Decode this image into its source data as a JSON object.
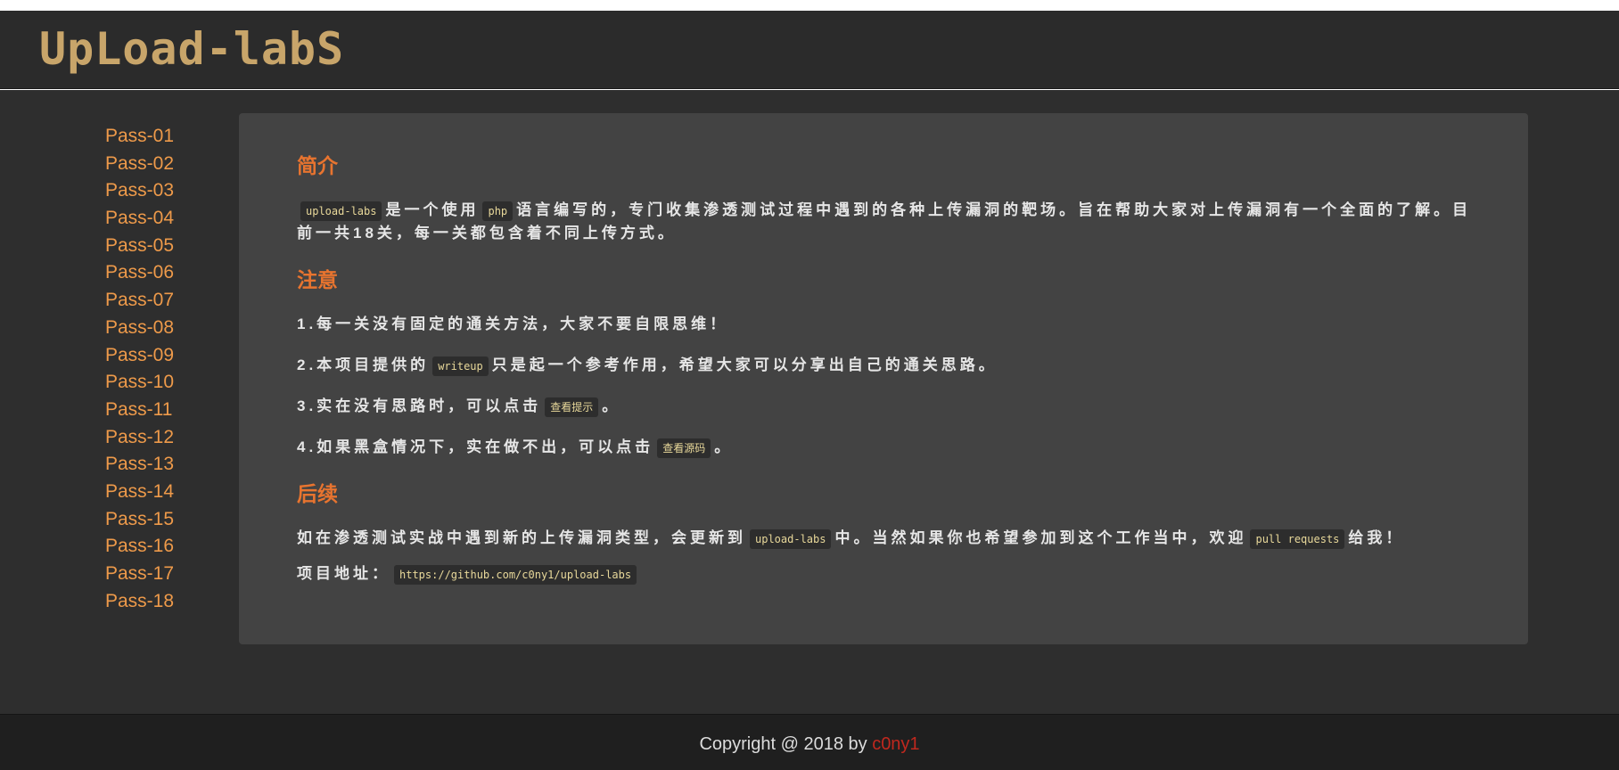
{
  "header": {
    "logo": "UpLoad-labS"
  },
  "sidebar": {
    "items": [
      "Pass-01",
      "Pass-02",
      "Pass-03",
      "Pass-04",
      "Pass-05",
      "Pass-06",
      "Pass-07",
      "Pass-08",
      "Pass-09",
      "Pass-10",
      "Pass-11",
      "Pass-12",
      "Pass-13",
      "Pass-14",
      "Pass-15",
      "Pass-16",
      "Pass-17",
      "Pass-18"
    ]
  },
  "intro": {
    "title": "简介",
    "code_upload_labs": "upload-labs",
    "text1": "是一个使用",
    "code_php": "php",
    "text2": "语言编写的，专门收集渗透测试过程中遇到的各种上传漏洞的靶场。旨在帮助大家对上传漏洞有一个全面的了解。目前一共18关，每一关都包含着不同上传方式。"
  },
  "notice": {
    "title": "注意",
    "item1": "1.每一关没有固定的通关方法，大家不要自限思维！",
    "item2_pre": "2.本项目提供的",
    "item2_code": "writeup",
    "item2_post": "只是起一个参考作用，希望大家可以分享出自己的通关思路。",
    "item3_pre": "3.实在没有思路时，可以点击",
    "item3_code": "查看提示",
    "item3_post": "。",
    "item4_pre": "4.如果黑盒情况下，实在做不出，可以点击",
    "item4_code": "查看源码",
    "item4_post": "。"
  },
  "followup": {
    "title": "后续",
    "text1": "如在渗透测试实战中遇到新的上传漏洞类型，会更新到",
    "code1": "upload-labs",
    "text2": "中。当然如果你也希望参加到这个工作当中，欢迎",
    "code2": "pull requests",
    "text3": "给我！",
    "address_label": "项目地址：",
    "address_url": "https://github.com/c0ny1/upload-labs"
  },
  "footer": {
    "copyright": "Copyright @ 2018 by ",
    "author": "c0ny1"
  },
  "colors": {
    "accent": "#e8742f",
    "sidebar_link": "#ee9a4a",
    "logo": "#c8a56a",
    "author": "#c0281e"
  }
}
